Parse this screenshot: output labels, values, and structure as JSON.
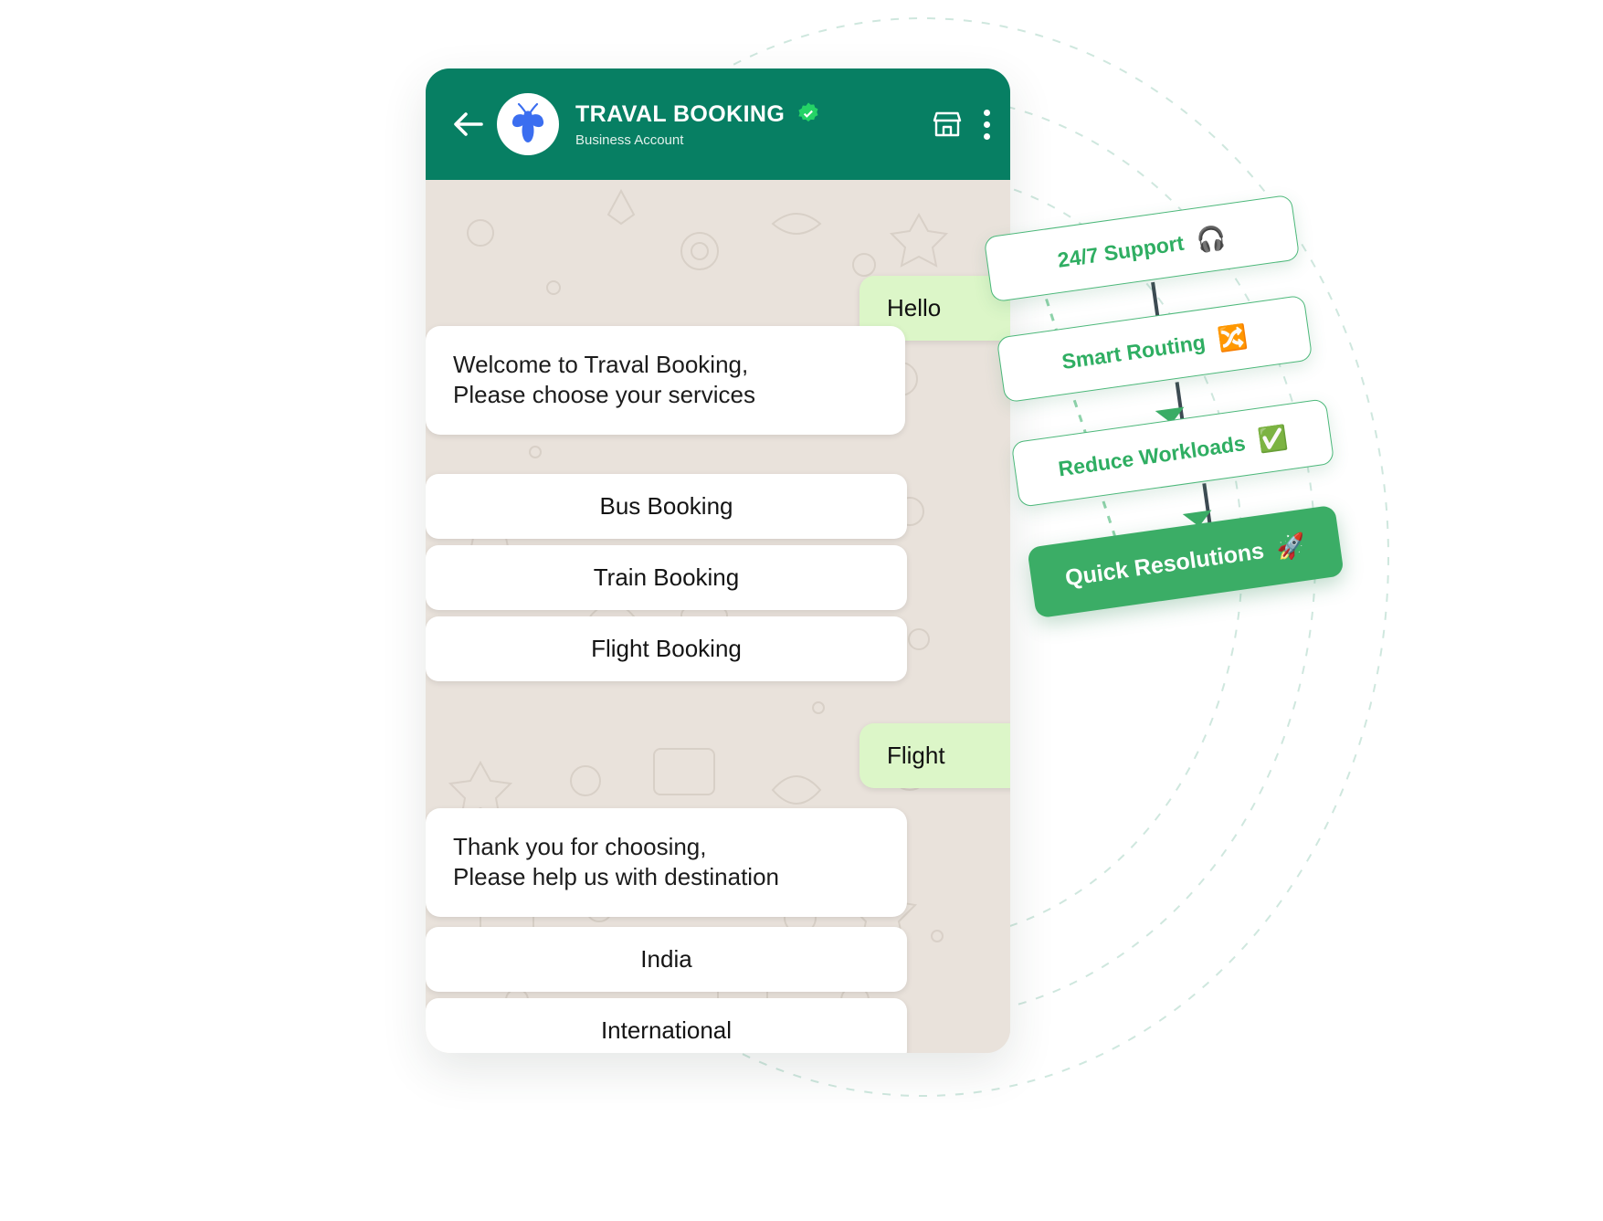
{
  "header": {
    "back_icon": "back-arrow-icon",
    "avatar_icon": "mosquito-logo-icon",
    "title": "TRAVAL BOOKING",
    "verified_icon": "verified-badge-icon",
    "subtitle": "Business Account",
    "store_icon": "storefront-icon",
    "menu_icon": "three-dots-menu-icon",
    "bg_color": "#077f63"
  },
  "chat": {
    "hello": "Hello",
    "welcome_line1": "Welcome to Traval Booking,",
    "welcome_line2": "Please choose your services",
    "options_services": [
      {
        "label": "Bus Booking"
      },
      {
        "label": "Train Booking"
      },
      {
        "label": "Flight Booking"
      }
    ],
    "flight_reply": "Flight",
    "thanks_line1": "Thank you for choosing,",
    "thanks_line2": "Please help us with destination",
    "options_destination": [
      {
        "label": "India"
      },
      {
        "label": "International"
      }
    ],
    "outgoing_bubble_color": "#dcf6c8",
    "incoming_bubble_color": "#ffffff"
  },
  "flow": {
    "cards": [
      {
        "label": "24/7 Support",
        "icon": "headset-support-icon",
        "emoji": "🎧",
        "style": "light"
      },
      {
        "label": "Smart Routing",
        "icon": "shuffle-routing-icon",
        "emoji": "🔀",
        "style": "light"
      },
      {
        "label": "Reduce Workloads",
        "icon": "check-circle-icon",
        "emoji": "✅",
        "style": "light"
      },
      {
        "label": "Quick Resolutions",
        "icon": "rocket-icon",
        "emoji": "🚀",
        "style": "solid"
      }
    ],
    "accent_color": "#3bad66",
    "light_text_color": "#2fae62"
  }
}
